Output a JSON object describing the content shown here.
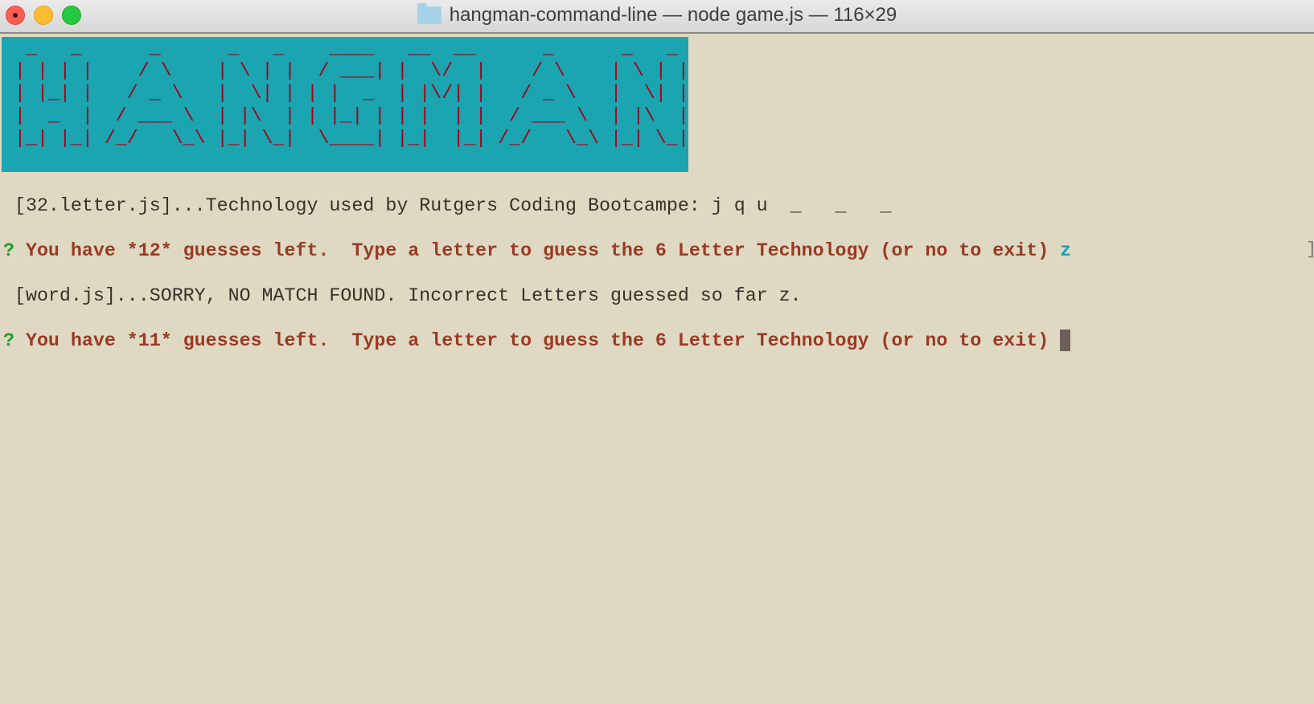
{
  "window": {
    "title": "hangman-command-line — node game.js — 116×29"
  },
  "banner": {
    "text": "HANGMAN",
    "letters": [
      {
        "char": "H",
        "rows": [
          " _   _ ",
          "| | | |",
          "| |_| |",
          "|  _  |",
          "|_| |_|"
        ]
      },
      {
        "char": "A",
        "rows": [
          "    _    ",
          "   / \\   ",
          "  / _ \\  ",
          " / ___ \\ ",
          "/_/   \\_\\"
        ]
      },
      {
        "char": "N",
        "rows": [
          " _   _ ",
          "| \\ | |",
          "|  \\| |",
          "| |\\  |",
          "|_| \\_|"
        ]
      },
      {
        "char": "G",
        "rows": [
          "  ____ ",
          " / ___|",
          "| |  _ ",
          "| |_| |",
          " \\____|"
        ]
      },
      {
        "char": "M",
        "rows": [
          " __  __ ",
          "|  \\/  |",
          "| |\\/| |",
          "| |  | |",
          "|_|  |_|"
        ]
      },
      {
        "char": "A",
        "rows": [
          "    _    ",
          "   / \\   ",
          "  / _ \\  ",
          " / ___ \\ ",
          "/_/   \\_\\"
        ]
      },
      {
        "char": "N",
        "rows": [
          " _   _ ",
          "| \\ | |",
          "|  \\| |",
          "| |\\  |",
          "|_| \\_|"
        ]
      }
    ]
  },
  "output": {
    "word_line": " [32.letter.js]...Technology used by Rutgers Coding Bootcampe: j q u  _   _   _",
    "prompt1": {
      "mark": "? ",
      "message": "You have *12* guesses left.  Type a letter to guess the 6 Letter Technology (or no to exit) ",
      "answer": "z"
    },
    "result_line": " [word.js]...SORRY, NO MATCH FOUND. Incorrect Letters guessed so far z.",
    "prompt2": {
      "mark": "? ",
      "message": "You have *11* guesses left.  Type a letter to guess the 6 Letter Technology (or no to exit) ",
      "answer": ""
    },
    "edge_mark": "]"
  },
  "colors": {
    "background": "#dfd9c3",
    "banner_bg": "#1aa5b0",
    "banner_fg": "#a3001c",
    "prompt": "#9a3a22",
    "question_mark": "#1f9e2a",
    "answer": "#1aa0b5"
  }
}
